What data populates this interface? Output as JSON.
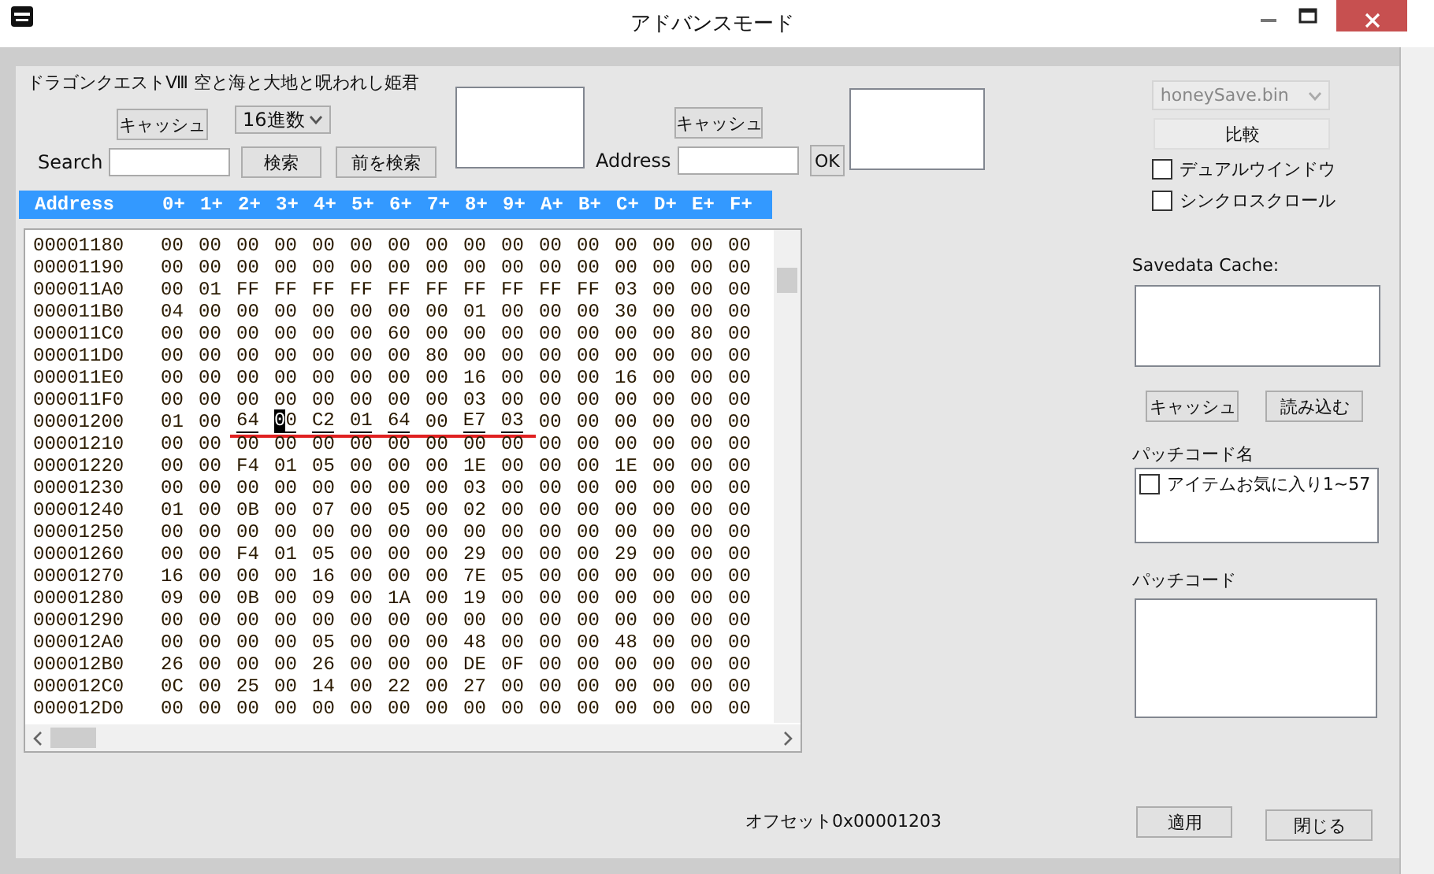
{
  "window": {
    "title": "アドバンスモード"
  },
  "top": {
    "game_title": "ドラゴンクエストⅧ 空と海と大地と呪われし姫君",
    "cache_button": "キャッシュ",
    "mode_select": "16進数",
    "search_label": "Search",
    "search_button": "検索",
    "prev_search_button": "前を検索",
    "address_cache_button": "キャッシュ",
    "address_label": "Address",
    "ok_button": "OK"
  },
  "hex_view": {
    "address_heading": "Address",
    "columns": [
      "0+",
      "1+",
      "2+",
      "3+",
      "4+",
      "5+",
      "6+",
      "7+",
      "8+",
      "9+",
      "A+",
      "B+",
      "C+",
      "D+",
      "E+",
      "F+"
    ],
    "rows": [
      {
        "address": "00001180",
        "bytes": [
          "00",
          "00",
          "00",
          "00",
          "00",
          "00",
          "00",
          "00",
          "00",
          "00",
          "00",
          "00",
          "00",
          "00",
          "00",
          "00"
        ]
      },
      {
        "address": "00001190",
        "bytes": [
          "00",
          "00",
          "00",
          "00",
          "00",
          "00",
          "00",
          "00",
          "00",
          "00",
          "00",
          "00",
          "00",
          "00",
          "00",
          "00"
        ]
      },
      {
        "address": "000011A0",
        "bytes": [
          "00",
          "01",
          "FF",
          "FF",
          "FF",
          "FF",
          "FF",
          "FF",
          "FF",
          "FF",
          "FF",
          "FF",
          "03",
          "00",
          "00",
          "00"
        ]
      },
      {
        "address": "000011B0",
        "bytes": [
          "04",
          "00",
          "00",
          "00",
          "00",
          "00",
          "00",
          "00",
          "01",
          "00",
          "00",
          "00",
          "30",
          "00",
          "00",
          "00"
        ]
      },
      {
        "address": "000011C0",
        "bytes": [
          "00",
          "00",
          "00",
          "00",
          "00",
          "00",
          "60",
          "00",
          "00",
          "00",
          "00",
          "00",
          "00",
          "00",
          "80",
          "00"
        ]
      },
      {
        "address": "000011D0",
        "bytes": [
          "00",
          "00",
          "00",
          "00",
          "00",
          "00",
          "00",
          "80",
          "00",
          "00",
          "00",
          "00",
          "00",
          "00",
          "00",
          "00"
        ]
      },
      {
        "address": "000011E0",
        "bytes": [
          "00",
          "00",
          "00",
          "00",
          "00",
          "00",
          "00",
          "00",
          "16",
          "00",
          "00",
          "00",
          "16",
          "00",
          "00",
          "00"
        ]
      },
      {
        "address": "000011F0",
        "bytes": [
          "00",
          "00",
          "00",
          "00",
          "00",
          "00",
          "00",
          "00",
          "03",
          "00",
          "00",
          "00",
          "00",
          "00",
          "00",
          "00"
        ]
      },
      {
        "address": "00001200",
        "bytes": [
          "01",
          "00",
          "64",
          "00",
          "C2",
          "01",
          "64",
          "00",
          "E7",
          "03",
          "00",
          "00",
          "00",
          "00",
          "00",
          "00"
        ],
        "modified": [
          false,
          false,
          true,
          true,
          true,
          true,
          true,
          false,
          true,
          true,
          false,
          false,
          false,
          false,
          false,
          false
        ],
        "cursor": [
          false,
          false,
          false,
          true,
          false,
          false,
          false,
          false,
          false,
          false,
          false,
          false,
          false,
          false,
          false,
          false
        ]
      },
      {
        "address": "00001210",
        "bytes": [
          "00",
          "00",
          "00",
          "00",
          "00",
          "00",
          "00",
          "00",
          "00",
          "00",
          "00",
          "00",
          "00",
          "00",
          "00",
          "00"
        ]
      },
      {
        "address": "00001220",
        "bytes": [
          "00",
          "00",
          "F4",
          "01",
          "05",
          "00",
          "00",
          "00",
          "1E",
          "00",
          "00",
          "00",
          "1E",
          "00",
          "00",
          "00"
        ]
      },
      {
        "address": "00001230",
        "bytes": [
          "00",
          "00",
          "00",
          "00",
          "00",
          "00",
          "00",
          "00",
          "03",
          "00",
          "00",
          "00",
          "00",
          "00",
          "00",
          "00"
        ]
      },
      {
        "address": "00001240",
        "bytes": [
          "01",
          "00",
          "0B",
          "00",
          "07",
          "00",
          "05",
          "00",
          "02",
          "00",
          "00",
          "00",
          "00",
          "00",
          "00",
          "00"
        ]
      },
      {
        "address": "00001250",
        "bytes": [
          "00",
          "00",
          "00",
          "00",
          "00",
          "00",
          "00",
          "00",
          "00",
          "00",
          "00",
          "00",
          "00",
          "00",
          "00",
          "00"
        ]
      },
      {
        "address": "00001260",
        "bytes": [
          "00",
          "00",
          "F4",
          "01",
          "05",
          "00",
          "00",
          "00",
          "29",
          "00",
          "00",
          "00",
          "29",
          "00",
          "00",
          "00"
        ]
      },
      {
        "address": "00001270",
        "bytes": [
          "16",
          "00",
          "00",
          "00",
          "16",
          "00",
          "00",
          "00",
          "7E",
          "05",
          "00",
          "00",
          "00",
          "00",
          "00",
          "00"
        ]
      },
      {
        "address": "00001280",
        "bytes": [
          "09",
          "00",
          "0B",
          "00",
          "09",
          "00",
          "1A",
          "00",
          "19",
          "00",
          "00",
          "00",
          "00",
          "00",
          "00",
          "00"
        ]
      },
      {
        "address": "00001290",
        "bytes": [
          "00",
          "00",
          "00",
          "00",
          "00",
          "00",
          "00",
          "00",
          "00",
          "00",
          "00",
          "00",
          "00",
          "00",
          "00",
          "00"
        ]
      },
      {
        "address": "000012A0",
        "bytes": [
          "00",
          "00",
          "00",
          "00",
          "05",
          "00",
          "00",
          "00",
          "48",
          "00",
          "00",
          "00",
          "48",
          "00",
          "00",
          "00"
        ]
      },
      {
        "address": "000012B0",
        "bytes": [
          "26",
          "00",
          "00",
          "00",
          "26",
          "00",
          "00",
          "00",
          "DE",
          "0F",
          "00",
          "00",
          "00",
          "00",
          "00",
          "00"
        ]
      },
      {
        "address": "000012C0",
        "bytes": [
          "0C",
          "00",
          "25",
          "00",
          "14",
          "00",
          "22",
          "00",
          "27",
          "00",
          "00",
          "00",
          "00",
          "00",
          "00",
          "00"
        ]
      },
      {
        "address": "000012D0",
        "bytes": [
          "00",
          "00",
          "00",
          "00",
          "00",
          "00",
          "00",
          "00",
          "00",
          "00",
          "00",
          "00",
          "00",
          "00",
          "00",
          "00"
        ]
      }
    ]
  },
  "offset": "オフセット0x00001203",
  "side": {
    "file_select": {
      "value": "honeySave.bin",
      "disabled": true
    },
    "compare_button": "比較",
    "options": [
      {
        "label": "デュアルウインドウ",
        "checked": false
      },
      {
        "label": "シンクロスクロール",
        "checked": false
      }
    ],
    "cache_label": "Savedata Cache:",
    "cache_button": "キャッシュ",
    "load_button": "読み込む",
    "patch_name_label": "パッチコード名",
    "patches": [
      {
        "label": "アイテムお気に入り1~57",
        "checked": false
      }
    ],
    "patch_code_label": "パッチコード",
    "apply_button": "適用",
    "close_button": "閉じる"
  }
}
